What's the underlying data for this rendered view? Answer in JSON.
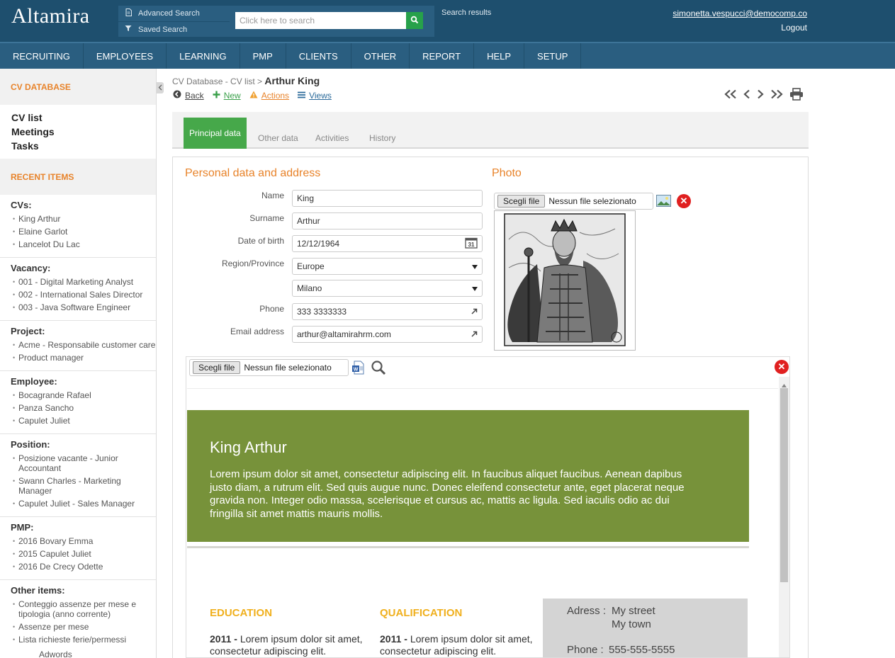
{
  "app": {
    "logo": "Altamira",
    "advanced_search": "Advanced Search",
    "saved_search": "Saved Search",
    "search_placeholder": "Click here to search",
    "search_results": "Search results",
    "user_email": "simonetta.vespucci@democomp.co",
    "logout": "Logout"
  },
  "nav": [
    "RECRUITING",
    "EMPLOYEES",
    "LEARNING",
    "PMP",
    "CLIENTS",
    "OTHER",
    "REPORT",
    "HELP",
    "SETUP"
  ],
  "sidebar": {
    "cv_database": "CV DATABASE",
    "links": [
      "CV list",
      "Meetings",
      "Tasks"
    ],
    "recent_items": "RECENT ITEMS",
    "groups": [
      {
        "title": "CVs:",
        "items": [
          "King Arthur",
          "Elaine Garlot",
          "Lancelot Du Lac"
        ]
      },
      {
        "title": "Vacancy:",
        "items": [
          "001 - Digital Marketing Analyst",
          "002 - International Sales Director",
          "003 - Java Software Engineer"
        ]
      },
      {
        "title": "Project:",
        "items": [
          "Acme - Responsabile customer care",
          "Product manager"
        ]
      },
      {
        "title": "Employee:",
        "items": [
          "Bocagrande Rafael",
          "Panza Sancho",
          "Capulet Juliet"
        ]
      },
      {
        "title": "Position:",
        "items": [
          "Posizione vacante - Junior Accountant",
          "Swann Charles - Marketing Manager",
          "Capulet Juliet - Sales Manager"
        ]
      },
      {
        "title": "PMP:",
        "items": [
          "2016 Bovary Emma",
          "2015 Capulet Juliet",
          "2016 De Crecy Odette"
        ]
      },
      {
        "title": "Other items:",
        "items": [
          "Conteggio assenze per mese e tipologia (anno corrente)",
          "Assenze per mese",
          "Lista richieste ferie/permessi"
        ]
      }
    ],
    "cut_item": "Adwords"
  },
  "breadcrumb": {
    "path": "CV Database - CV list > ",
    "current": "Arthur King"
  },
  "actions": {
    "back": "Back",
    "new": "New",
    "actions": "Actions",
    "views": "Views"
  },
  "tabs": [
    "Principal data",
    "Other data",
    "Activities",
    "History"
  ],
  "form": {
    "section_title": "Personal data and address",
    "photo_title": "Photo",
    "name_label": "Name",
    "name_value": "King",
    "surname_label": "Surname",
    "surname_value": "Arthur",
    "dob_label": "Date of birth",
    "dob_value": "12/12/1964",
    "region_label": "Region/Province",
    "region_value": "Europe",
    "province_value": "Milano",
    "phone_label": "Phone",
    "phone_value": "333 3333333",
    "email_label": "Email address",
    "email_value": "arthur@altamirahrm.com",
    "file_button": "Scegli file",
    "no_file": "Nessun file selezionato",
    "calendar_day": "31"
  },
  "cv": {
    "name": "King Arthur",
    "intro": "Lorem ipsum dolor sit amet, consectetur adipiscing elit. In faucibus aliquet faucibus. Aenean dapibus justo diam, a rutrum elit. Sed quis augue nunc. Donec eleifend consectetur ante, eget placerat neque gravida non. Integer odio massa, scelerisque et cursus ac, mattis ac ligula. Sed iaculis odio ac dui fringilla sit amet mattis mauris mollis.",
    "education": "EDUCATION",
    "qualification": "QUALIFICATION",
    "edu_year": "2011 -",
    "edu_text": "Lorem ipsum dolor sit amet, consectetur adipiscing elit.",
    "qual_year": "2011 -",
    "qual_text": "Lorem ipsum dolor sit amet, consectetur adipiscing elit.",
    "address_label": "Adress :",
    "address_line1": "My street",
    "address_line2": "My town",
    "phone_label": "Phone :",
    "phone_value": "555-555-5555"
  },
  "colors": {
    "header": "#1e4f6e",
    "nav": "#2a5e80",
    "accent": "#e8832a",
    "tab_active": "#46a84a",
    "cv_banner": "#77923a",
    "cv_heading": "#f0b01e"
  }
}
